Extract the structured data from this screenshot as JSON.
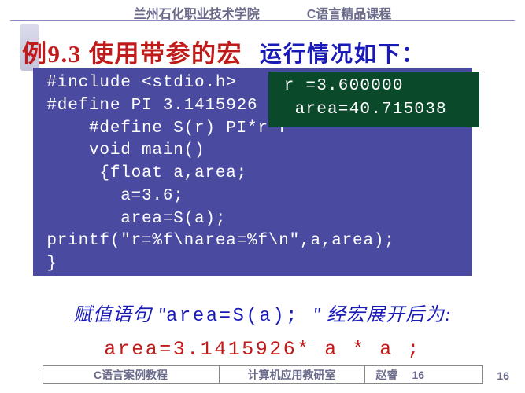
{
  "header": {
    "left": "兰州石化职业技术学院",
    "right": "C语言精品课程"
  },
  "title": {
    "red": "例9.3 使用带参的宏",
    "blue": "运行情况如下："
  },
  "code": " #include <stdio.h>\n #define PI 3.1415926\n     #define S(r) PI*r*r\n     void main()\n      {float a,area;\n        a=3.6;\n        area=S(a);\n printf(\"r=%f\\narea=%f\\n\",a,area);\n }",
  "output": " r =3.600000\n  area=40.715038",
  "explanation": {
    "line1_prefix": "赋值语句 \"",
    "line1_code": "area=S(a); ",
    "line1_suffix": "\" 经宏展开后为:",
    "line2": "area=3.1415926* a * a ;"
  },
  "footer": {
    "c1": "C语言案例教程",
    "c2": "计算机应用教研室",
    "c3_author": "赵睿",
    "c3_page": "16",
    "pagenum_corner": "16"
  }
}
